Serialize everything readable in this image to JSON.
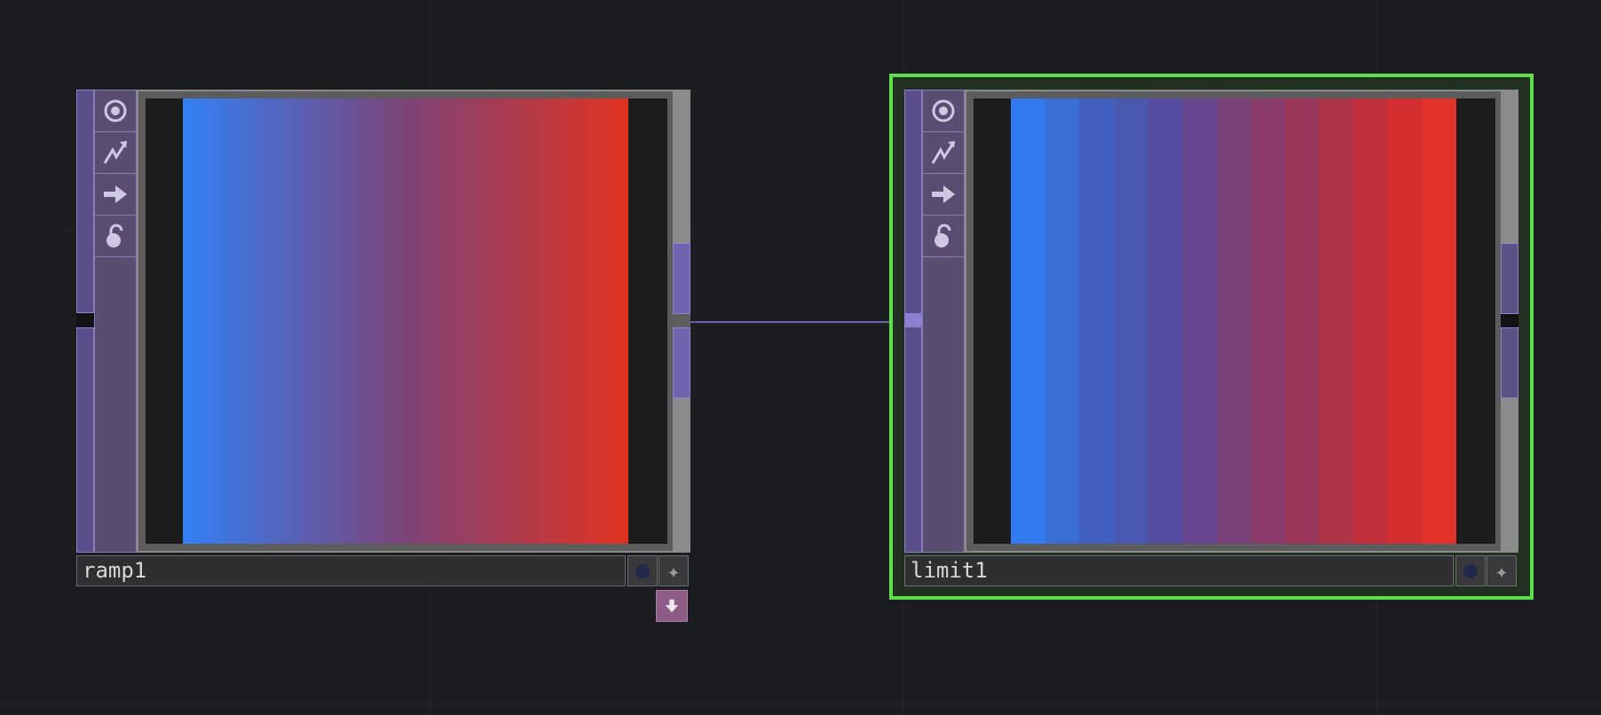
{
  "nodes": [
    {
      "name": "ramp1",
      "gradient": [
        "#3380f6",
        "#7d4477",
        "#e23322"
      ],
      "buttons": [
        "viewer-icon",
        "cook-icon",
        "bypass-icon",
        "lock-icon"
      ]
    },
    {
      "name": "limit1",
      "stepped_colors": [
        "#3379f0",
        "#3a6fd6",
        "#4061c0",
        "#4a58b0",
        "#554ea0",
        "#674690",
        "#7a407b",
        "#893b6a",
        "#9a375a",
        "#ad3449",
        "#c2303c",
        "#d42f30",
        "#e2322a"
      ],
      "buttons": [
        "viewer-icon",
        "cook-icon",
        "bypass-icon",
        "lock-icon"
      ]
    }
  ],
  "colors": {
    "selection": "#5fe04a",
    "wire": "#6a63a8"
  }
}
